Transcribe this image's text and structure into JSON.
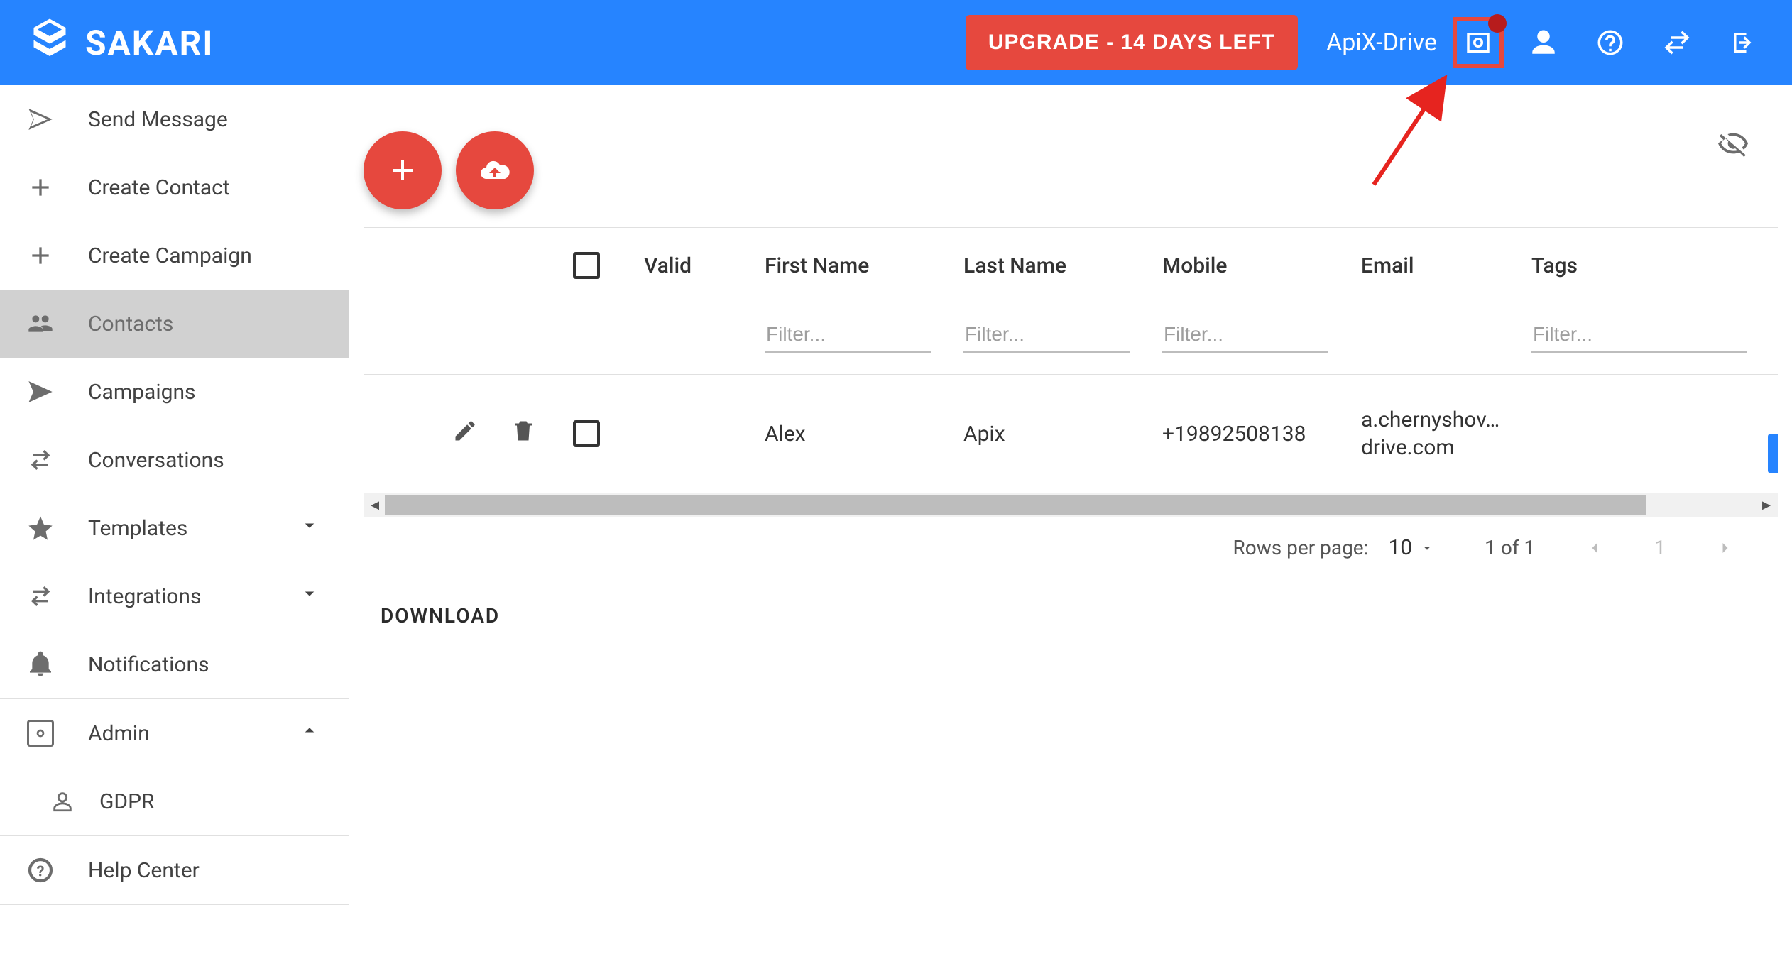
{
  "brand": {
    "name": "SAKARI"
  },
  "topbar": {
    "upgrade_label": "UPGRADE - 14 DAYS LEFT",
    "account_name": "ApiX-Drive"
  },
  "sidebar": {
    "items": [
      {
        "label": "Send Message"
      },
      {
        "label": "Create Contact"
      },
      {
        "label": "Create Campaign"
      },
      {
        "label": "Contacts"
      },
      {
        "label": "Campaigns"
      },
      {
        "label": "Conversations"
      },
      {
        "label": "Templates"
      },
      {
        "label": "Integrations"
      },
      {
        "label": "Notifications"
      },
      {
        "label": "Admin"
      }
    ],
    "sub_gdpr": "GDPR",
    "help_center": "Help Center"
  },
  "table": {
    "headers": {
      "valid": "Valid",
      "first_name": "First Name",
      "last_name": "Last Name",
      "mobile": "Mobile",
      "email": "Email",
      "tags": "Tags"
    },
    "filter_placeholder": "Filter...",
    "rows": [
      {
        "first_name": "Alex",
        "last_name": "Apix",
        "mobile": "+19892508138",
        "email_line1": "a.chernyshov…",
        "email_line2": "drive.com"
      }
    ]
  },
  "pager": {
    "rows_per_page_label": "Rows per page:",
    "rows_per_page_value": "10",
    "range_text": "1 of 1",
    "page_number": "1"
  },
  "download_label": "DOWNLOAD"
}
